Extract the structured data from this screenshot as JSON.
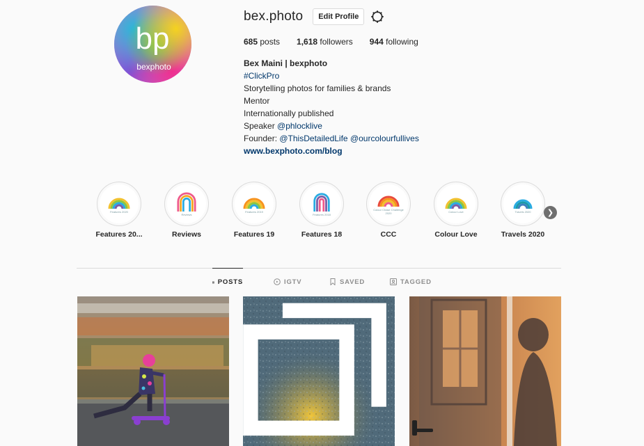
{
  "profile": {
    "username": "bex.photo",
    "edit_label": "Edit Profile",
    "avatar_text": "bp",
    "avatar_caption": "bexphoto",
    "stats": [
      {
        "count": "685",
        "label": " posts"
      },
      {
        "count": "1,618",
        "label": " followers"
      },
      {
        "count": "944",
        "label": " following"
      }
    ],
    "bio": {
      "name": "Bex Maini | bexphoto",
      "hashtag": "#ClickPro",
      "line1": "Storytelling photos for families & brands",
      "line2": "Mentor",
      "line3": "Internationally published",
      "speaker_prefix": "Speaker ",
      "speaker_handle": "@phlocklive",
      "founder_prefix": "Founder: ",
      "founder_handle1": "@ThisDetailedLife",
      "founder_handle2": "@ourcolourfullives",
      "website": "www.bexphoto.com/blog"
    }
  },
  "highlights": [
    {
      "label": "Features 20...",
      "cover_text": "Features 2020"
    },
    {
      "label": "Reviews",
      "cover_text": "Reviews"
    },
    {
      "label": "Features 19",
      "cover_text": "Features 2019"
    },
    {
      "label": "Features 18",
      "cover_text": "Features 2018"
    },
    {
      "label": "CCC",
      "cover_text": "Colour Chase Challenge 2020"
    },
    {
      "label": "Colour Love",
      "cover_text": "Colour Love"
    },
    {
      "label": "Travels 2020",
      "cover_text": "Travels 2020"
    }
  ],
  "highlights_next_icon": "chevron-right-icon",
  "tabs": [
    {
      "label": "POSTS",
      "icon": "grid-icon",
      "active": true
    },
    {
      "label": "IGTV",
      "icon": "igtv-icon",
      "active": false
    },
    {
      "label": "SAVED",
      "icon": "bookmark-icon",
      "active": false
    },
    {
      "label": "TAGGED",
      "icon": "tagged-icon",
      "active": false
    }
  ],
  "colors": {
    "link": "#00376b",
    "border": "#dbdbdb",
    "background": "#fafafa",
    "text": "#262626",
    "muted": "#8e8e8e"
  }
}
